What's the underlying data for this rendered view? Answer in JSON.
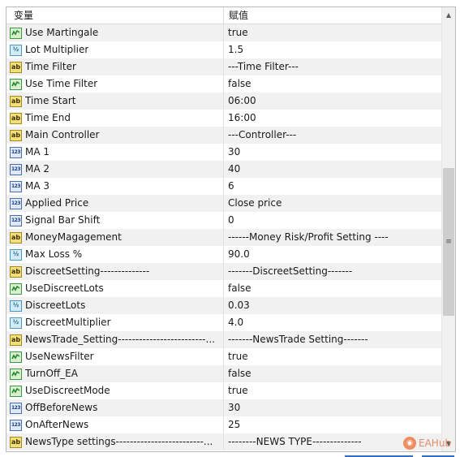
{
  "header": {
    "col_variable": "变量",
    "col_value": "赋值"
  },
  "rows": [
    {
      "type": "bool",
      "name": "Use Martingale",
      "value": "true"
    },
    {
      "type": "dbl",
      "name": "Lot Multiplier",
      "value": "1.5"
    },
    {
      "type": "str",
      "name": "Time Filter",
      "value": "---Time Filter---"
    },
    {
      "type": "bool",
      "name": "Use Time Filter",
      "value": "false"
    },
    {
      "type": "str",
      "name": "Time Start",
      "value": "06:00"
    },
    {
      "type": "str",
      "name": "Time End",
      "value": "16:00"
    },
    {
      "type": "str",
      "name": "Main Controller",
      "value": "---Controller---"
    },
    {
      "type": "int",
      "name": "MA 1",
      "value": "30"
    },
    {
      "type": "int",
      "name": "MA 2",
      "value": "40"
    },
    {
      "type": "int",
      "name": "MA 3",
      "value": "6"
    },
    {
      "type": "int",
      "name": "Applied Price",
      "value": "Close price"
    },
    {
      "type": "int",
      "name": "Signal Bar Shift",
      "value": "0"
    },
    {
      "type": "str",
      "name": "MoneyMagagement",
      "value": "------Money Risk/Profit Setting ----"
    },
    {
      "type": "dbl",
      "name": "Max Loss %",
      "value": "90.0"
    },
    {
      "type": "str",
      "name": "DiscreetSetting--------------",
      "value": "-------DiscreetSetting-------"
    },
    {
      "type": "bool",
      "name": "UseDiscreetLots",
      "value": "false"
    },
    {
      "type": "dbl",
      "name": "DiscreetLots",
      "value": "0.03"
    },
    {
      "type": "dbl",
      "name": "DiscreetMultiplier",
      "value": "4.0"
    },
    {
      "type": "str",
      "name": "NewsTrade_Setting-------------------------...",
      "value": "-------NewsTrade Setting-------"
    },
    {
      "type": "bool",
      "name": "UseNewsFilter",
      "value": "true"
    },
    {
      "type": "bool",
      "name": "TurnOff_EA",
      "value": "false"
    },
    {
      "type": "bool",
      "name": "UseDiscreetMode",
      "value": "true"
    },
    {
      "type": "int",
      "name": "OffBeforeNews",
      "value": "30"
    },
    {
      "type": "int",
      "name": "OnAfterNews",
      "value": "25"
    },
    {
      "type": "str",
      "name": "NewsType settings-------------------------...",
      "value": "--------NEWS TYPE--------------"
    }
  ],
  "type_icons": {
    "bool": {
      "icon": "bool-icon"
    },
    "dbl": {
      "icon": "double-icon",
      "glyph": "½"
    },
    "str": {
      "icon": "string-icon",
      "glyph": "ab"
    },
    "int": {
      "icon": "integer-icon",
      "glyph": "123"
    }
  },
  "scrollbar": {
    "up_glyph": "▲",
    "down_glyph": "▼",
    "grip_glyph": "≡"
  },
  "watermark": {
    "text": "EAHub"
  },
  "colors": {
    "alt_row": "#f1f1f1",
    "border": "#b9b9b9",
    "accent": "#2f6fc4"
  }
}
